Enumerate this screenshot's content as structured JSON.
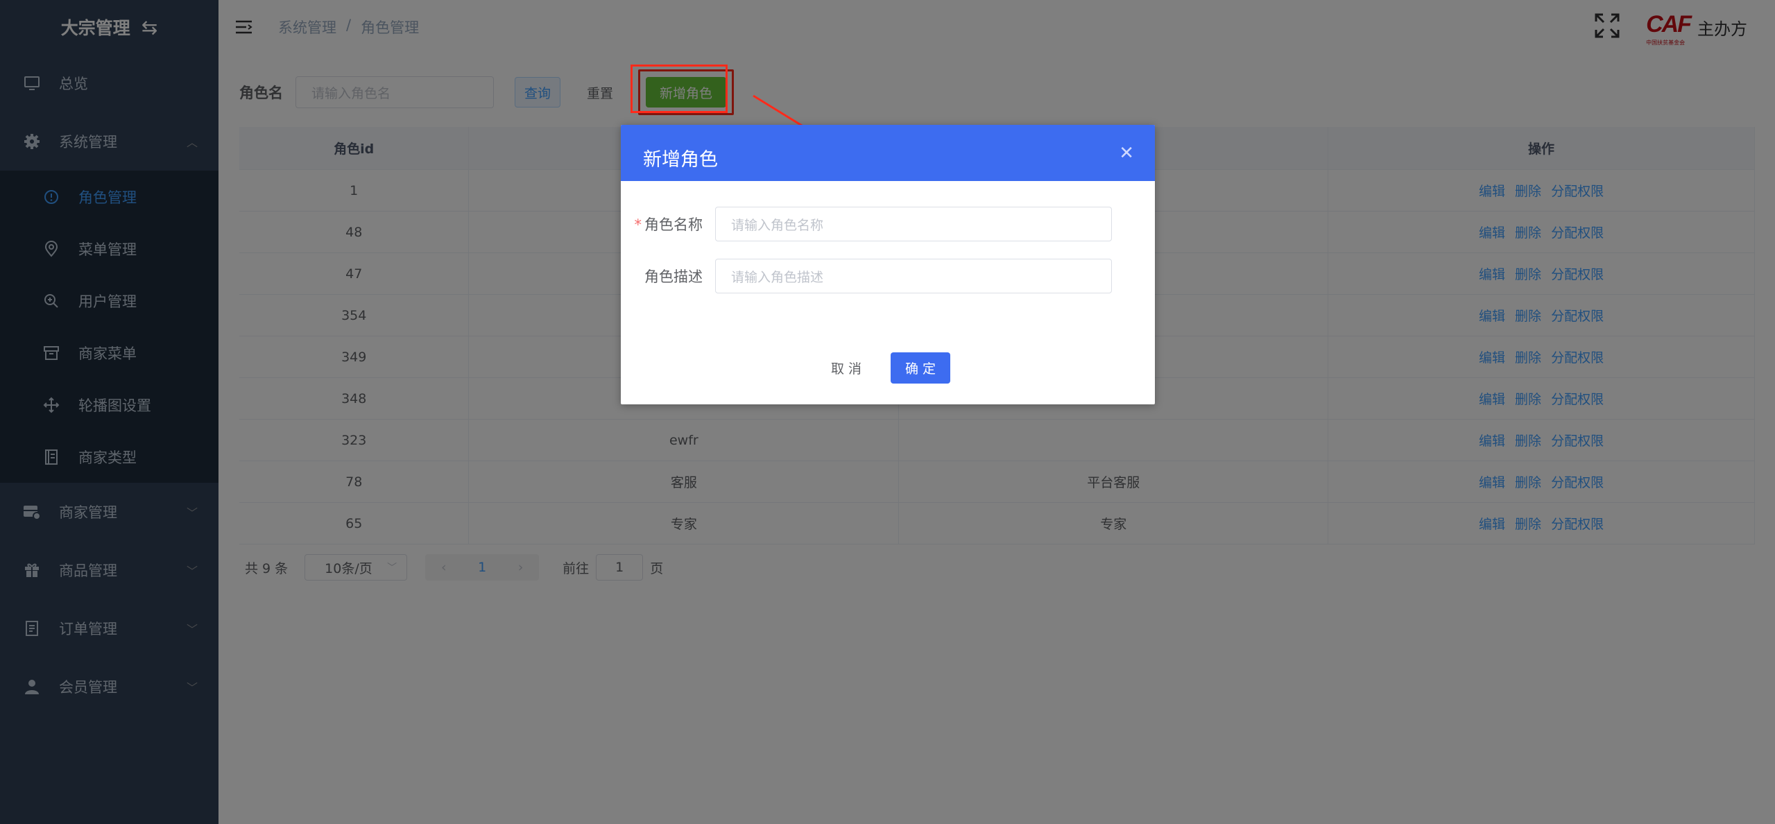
{
  "sidebar": {
    "logo_title": "大宗管理",
    "top_item": {
      "label": "总览",
      "icon": "monitor-icon"
    },
    "system_menu": {
      "label": "系统管理",
      "icon": "gear-icon",
      "items": [
        {
          "label": "角色管理",
          "icon": "info-circle-icon",
          "active": true
        },
        {
          "label": "菜单管理",
          "icon": "location-pin-icon"
        },
        {
          "label": "用户管理",
          "icon": "zoom-in-icon"
        },
        {
          "label": "商家菜单",
          "icon": "box-icon"
        },
        {
          "label": "轮播图设置",
          "icon": "move-arrows-icon"
        },
        {
          "label": "商家类型",
          "icon": "document-icon"
        }
      ]
    },
    "groups": [
      {
        "label": "商家管理",
        "icon": "store-icon"
      },
      {
        "label": "商品管理",
        "icon": "gift-icon"
      },
      {
        "label": "订单管理",
        "icon": "order-doc-icon"
      },
      {
        "label": "会员管理",
        "icon": "user-icon"
      }
    ]
  },
  "header": {
    "breadcrumb": [
      "系统管理",
      "角色管理"
    ],
    "separator": "/",
    "logo_text": "CAF",
    "logo_subtext": "中国扶贫基金会",
    "username": "主办方"
  },
  "filter": {
    "label": "角色名",
    "placeholder": "请输入角色名",
    "query_label": "查询",
    "reset_label": "重置",
    "add_label": "新增角色"
  },
  "table": {
    "headers": [
      "角色id",
      "",
      "",
      "操作"
    ],
    "ops": [
      "编辑",
      "删除",
      "分配权限"
    ],
    "rows": [
      {
        "id": "1",
        "name": "",
        "desc": ""
      },
      {
        "id": "48",
        "name": "",
        "desc": ""
      },
      {
        "id": "47",
        "name": "",
        "desc": ""
      },
      {
        "id": "354",
        "name": "",
        "desc": ""
      },
      {
        "id": "349",
        "name": "",
        "desc": ""
      },
      {
        "id": "348",
        "name": "",
        "desc": ""
      },
      {
        "id": "323",
        "name": "ewfr",
        "desc": ""
      },
      {
        "id": "78",
        "name": "客服",
        "desc": "平台客服"
      },
      {
        "id": "65",
        "name": "专家",
        "desc": "专家"
      }
    ]
  },
  "pagination": {
    "total": "共 9 条",
    "page_size": "10条/页",
    "current": "1",
    "goto_prefix": "前往",
    "goto_value": "1",
    "goto_suffix": "页"
  },
  "dialog": {
    "title": "新增角色",
    "name_label": "角色名称",
    "name_placeholder": "请输入角色名称",
    "desc_label": "角色描述",
    "desc_placeholder": "请输入角色描述",
    "cancel_label": "取 消",
    "ok_label": "确 定"
  },
  "colors": {
    "sidebar_bg": "#304156",
    "submenu_bg": "#1f2d3d",
    "active": "#409eff",
    "dialog_header": "#3d6cf0",
    "add_button": "#67c23a",
    "annotation": "#ff2a1a"
  }
}
